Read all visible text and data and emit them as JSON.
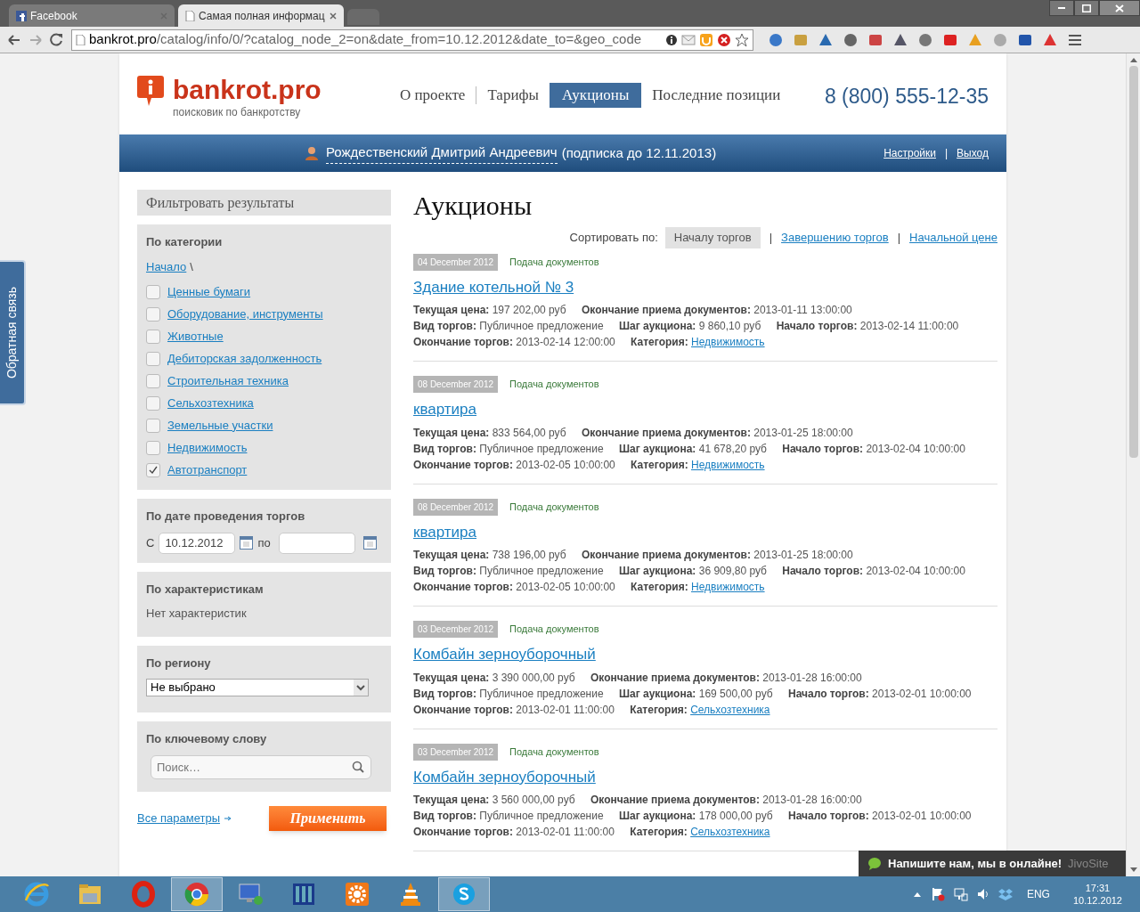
{
  "browser": {
    "tabs": [
      {
        "title": "Facebook",
        "selected": false
      },
      {
        "title": "Самая полная информац",
        "selected": true
      }
    ],
    "url_host": "bankrot.pro",
    "url_path": "/catalog/info/0/?catalog_node_2=on&date_from=10.12.2012&date_to=&geo_code"
  },
  "site": {
    "logo": "bankrot.pro",
    "tagline": "поисковик по банкротству",
    "nav": [
      {
        "label": "О проекте",
        "selected": false
      },
      {
        "label": "Тарифы",
        "selected": false
      },
      {
        "label": "Аукционы",
        "selected": true
      },
      {
        "label": "Последние позиции",
        "selected": false
      }
    ],
    "phone": "8 (800) 555-12-35"
  },
  "user_bar": {
    "user": "Рождественский Дмитрий Андреевич",
    "subscription": "(подписка до 12.11.2013)",
    "links": [
      "Настройки",
      "Выход"
    ],
    "separator": "|"
  },
  "feedback_tab": "Обратная связь",
  "sidebar": {
    "title": "Фильтровать результаты",
    "category": {
      "heading": "По категории",
      "breadcrumb": "Начало",
      "separator": "\\",
      "items": [
        {
          "label": "Ценные бумаги",
          "checked": false
        },
        {
          "label": "Оборудование, инструменты",
          "checked": false
        },
        {
          "label": "Животные",
          "checked": false
        },
        {
          "label": "Дебиторская задолженность",
          "checked": false
        },
        {
          "label": "Строительная техника",
          "checked": false
        },
        {
          "label": "Сельхозтехника",
          "checked": false
        },
        {
          "label": "Земельные участки",
          "checked": false
        },
        {
          "label": "Недвижимость",
          "checked": false
        },
        {
          "label": "Автотранспорт",
          "checked": true
        }
      ]
    },
    "date": {
      "heading": "По дате проведения торгов",
      "from_label": "С",
      "from_value": "10.12.2012",
      "to_label": "по"
    },
    "features": {
      "heading": "По характеристикам",
      "text": "Нет характеристик"
    },
    "region": {
      "heading": "По региону",
      "value": "Не выбрано"
    },
    "keyword": {
      "heading": "По ключевому слову",
      "placeholder": "Поиск…"
    },
    "all_params": "Все параметры",
    "apply": "Применить"
  },
  "main": {
    "title": "Аукционы",
    "sort_label": "Сортировать по:",
    "sort_separator": "|",
    "sort_options": [
      {
        "label": "Началу торгов",
        "selected": true
      },
      {
        "label": "Завершению торгов",
        "selected": false
      },
      {
        "label": "Начальной цене",
        "selected": false
      }
    ],
    "lots": [
      {
        "date": "04 December 2012",
        "status": "Подача документов",
        "title": "Здание котельной № 3",
        "fields": [
          {
            "label": "Текущая цена:",
            "value": "197 202,00 руб"
          },
          {
            "label": "Окончание приема документов:",
            "value": "2013-01-11 13:00:00"
          },
          {
            "label": "Вид торгов:",
            "value": "Публичное предложение"
          },
          {
            "label": "Шаг аукциона:",
            "value": "9 860,10 руб"
          },
          {
            "label": "Начало торгов:",
            "value": "2013-02-14 11:00:00"
          },
          {
            "label": "Окончание торгов:",
            "value": "2013-02-14 12:00:00"
          },
          {
            "label": "Категория:",
            "value": "Недвижимость",
            "kind": "link"
          }
        ]
      },
      {
        "date": "08 December 2012",
        "status": "Подача документов",
        "title": "квартира",
        "fields": [
          {
            "label": "Текущая цена:",
            "value": "833 564,00 руб"
          },
          {
            "label": "Окончание приема документов:",
            "value": "2013-01-25 18:00:00"
          },
          {
            "label": "Вид торгов:",
            "value": "Публичное предложение"
          },
          {
            "label": "Шаг аукциона:",
            "value": "41 678,20 руб"
          },
          {
            "label": "Начало торгов:",
            "value": "2013-02-04 10:00:00"
          },
          {
            "label": "Окончание торгов:",
            "value": "2013-02-05 10:00:00"
          },
          {
            "label": "Категория:",
            "value": "Недвижимость",
            "kind": "link"
          }
        ]
      },
      {
        "date": "08 December 2012",
        "status": "Подача документов",
        "title": "квартира",
        "fields": [
          {
            "label": "Текущая цена:",
            "value": "738 196,00 руб"
          },
          {
            "label": "Окончание приема документов:",
            "value": "2013-01-25 18:00:00"
          },
          {
            "label": "Вид торгов:",
            "value": "Публичное предложение"
          },
          {
            "label": "Шаг аукциона:",
            "value": "36 909,80 руб"
          },
          {
            "label": "Начало торгов:",
            "value": "2013-02-04 10:00:00"
          },
          {
            "label": "Окончание торгов:",
            "value": "2013-02-05 10:00:00"
          },
          {
            "label": "Категория:",
            "value": "Недвижимость",
            "kind": "link"
          }
        ]
      },
      {
        "date": "03 December 2012",
        "status": "Подача документов",
        "title": "Комбайн зерноуборочный",
        "fields": [
          {
            "label": "Текущая цена:",
            "value": "3 390 000,00 руб"
          },
          {
            "label": "Окончание приема документов:",
            "value": "2013-01-28 16:00:00"
          },
          {
            "label": "Вид торгов:",
            "value": "Публичное предложение"
          },
          {
            "label": "Шаг аукциона:",
            "value": "169 500,00 руб"
          },
          {
            "label": "Начало торгов:",
            "value": "2013-02-01 10:00:00"
          },
          {
            "label": "Окончание торгов:",
            "value": "2013-02-01 11:00:00"
          },
          {
            "label": "Категория:",
            "value": "Сельхозтехника",
            "kind": "link"
          }
        ]
      },
      {
        "date": "03 December 2012",
        "status": "Подача документов",
        "title": "Комбайн зерноуборочный",
        "fields": [
          {
            "label": "Текущая цена:",
            "value": "3 560 000,00 руб"
          },
          {
            "label": "Окончание приема документов:",
            "value": "2013-01-28 16:00:00"
          },
          {
            "label": "Вид торгов:",
            "value": "Публичное предложение"
          },
          {
            "label": "Шаг аукциона:",
            "value": "178 000,00 руб"
          },
          {
            "label": "Начало торгов:",
            "value": "2013-02-01 10:00:00"
          },
          {
            "label": "Окончание торгов:",
            "value": "2013-02-01 11:00:00"
          },
          {
            "label": "Категория:",
            "value": "Сельхозтехника",
            "kind": "link"
          }
        ]
      }
    ]
  },
  "chat": {
    "text": "Напишите нам, мы в онлайне!",
    "brand": "JivoSite"
  },
  "taskbar": {
    "apps": [
      {
        "kind": "browser-e",
        "selected": false
      },
      {
        "kind": "folder",
        "selected": false
      },
      {
        "kind": "ring",
        "selected": false
      },
      {
        "kind": "chrome",
        "selected": true
      },
      {
        "kind": "monitor",
        "selected": false
      },
      {
        "kind": "server",
        "selected": false
      },
      {
        "kind": "gear",
        "selected": false
      },
      {
        "kind": "cone",
        "selected": false
      },
      {
        "kind": "chat",
        "selected": true
      }
    ],
    "language": "ENG",
    "time": "17:31",
    "date": "10.12.2012"
  }
}
